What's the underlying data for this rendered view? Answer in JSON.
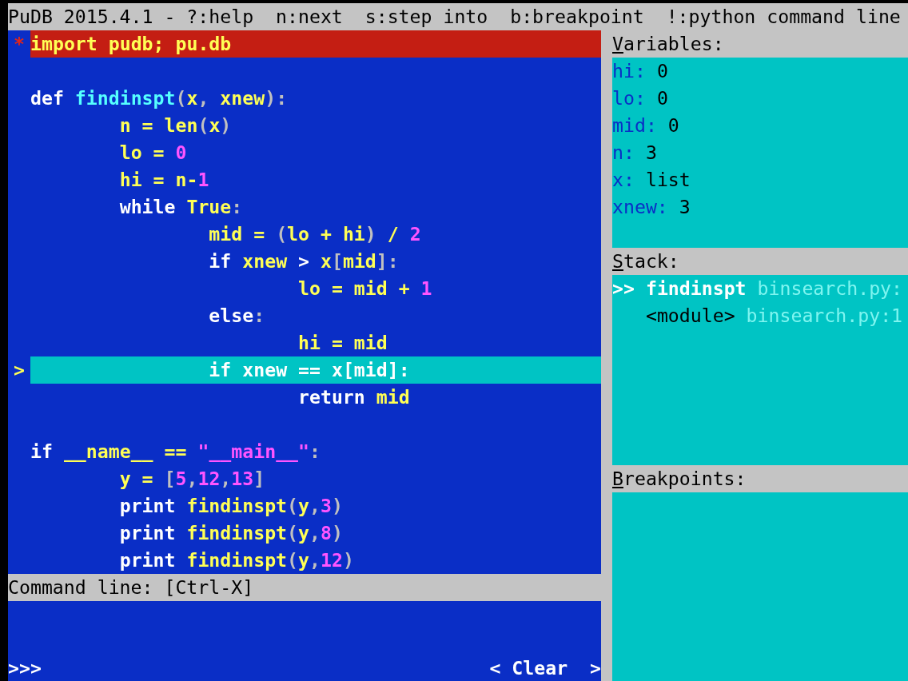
{
  "title_bar": {
    "text": "PuDB 2015.4.1 - ?:help  n:next  s:step into  b:breakpoint  !:python command line"
  },
  "source": {
    "lines": [
      {
        "kind": "breakpoint",
        "marker": "*",
        "tokens": [
          {
            "kind": "name",
            "t": "import pudb; pu.db"
          }
        ]
      },
      {
        "kind": "blank"
      },
      {
        "kind": "normal",
        "tokens": [
          {
            "kind": "kw",
            "t": "def "
          },
          {
            "kind": "func",
            "t": "findinspt"
          },
          {
            "kind": "punct",
            "t": "("
          },
          {
            "kind": "name",
            "t": "x"
          },
          {
            "kind": "punct",
            "t": ", "
          },
          {
            "kind": "name",
            "t": "xnew"
          },
          {
            "kind": "punct",
            "t": "):"
          }
        ],
        "children": [
          {
            "kind": "normal",
            "tokens": [
              {
                "kind": "name",
                "t": "n = len"
              },
              {
                "kind": "punct",
                "t": "("
              },
              {
                "kind": "name",
                "t": "x"
              },
              {
                "kind": "punct",
                "t": ")"
              }
            ]
          },
          {
            "kind": "normal",
            "tokens": [
              {
                "kind": "name",
                "t": "lo = "
              },
              {
                "kind": "num",
                "t": "0"
              }
            ]
          },
          {
            "kind": "normal",
            "tokens": [
              {
                "kind": "name",
                "t": "hi = n-"
              },
              {
                "kind": "num",
                "t": "1"
              }
            ]
          },
          {
            "kind": "normal",
            "tokens": [
              {
                "kind": "kw",
                "t": "while "
              },
              {
                "kind": "name",
                "t": "True"
              },
              {
                "kind": "punct",
                "t": ":"
              }
            ],
            "children": [
              {
                "kind": "normal",
                "tokens": [
                  {
                    "kind": "name",
                    "t": "mid = "
                  },
                  {
                    "kind": "punct",
                    "t": "("
                  },
                  {
                    "kind": "name",
                    "t": "lo + hi"
                  },
                  {
                    "kind": "punct",
                    "t": ")"
                  },
                  {
                    "kind": "name",
                    "t": " / "
                  },
                  {
                    "kind": "num",
                    "t": "2"
                  }
                ]
              },
              {
                "kind": "normal",
                "tokens": [
                  {
                    "kind": "kw",
                    "t": "if "
                  },
                  {
                    "kind": "name",
                    "t": "xnew "
                  },
                  {
                    "kind": "plain",
                    "t": "> "
                  },
                  {
                    "kind": "name",
                    "t": "x"
                  },
                  {
                    "kind": "punct",
                    "t": "["
                  },
                  {
                    "kind": "name",
                    "t": "mid"
                  },
                  {
                    "kind": "punct",
                    "t": "]:"
                  }
                ],
                "children": [
                  {
                    "kind": "normal",
                    "tokens": [
                      {
                        "kind": "name",
                        "t": "lo = mid + "
                      },
                      {
                        "kind": "num",
                        "t": "1"
                      }
                    ]
                  }
                ]
              },
              {
                "kind": "normal",
                "tokens": [
                  {
                    "kind": "kw",
                    "t": "else"
                  },
                  {
                    "kind": "punct",
                    "t": ":"
                  }
                ],
                "children": [
                  {
                    "kind": "normal",
                    "tokens": [
                      {
                        "kind": "name",
                        "t": "hi = mid"
                      }
                    ]
                  }
                ]
              },
              {
                "kind": "current",
                "marker": ">",
                "tokens": [
                  {
                    "kind": "kw",
                    "t": "if "
                  },
                  {
                    "kind": "name",
                    "t": "xnew == x"
                  },
                  {
                    "kind": "punct",
                    "t": "["
                  },
                  {
                    "kind": "name",
                    "t": "mid"
                  },
                  {
                    "kind": "punct",
                    "t": "]:"
                  }
                ],
                "children": [
                  {
                    "kind": "normal",
                    "tokens": [
                      {
                        "kind": "kw",
                        "t": "return "
                      },
                      {
                        "kind": "name",
                        "t": "mid"
                      }
                    ]
                  }
                ]
              }
            ]
          }
        ]
      },
      {
        "kind": "blank"
      },
      {
        "kind": "normal",
        "tokens": [
          {
            "kind": "kw",
            "t": "if "
          },
          {
            "kind": "name",
            "t": "__name__ == "
          },
          {
            "kind": "str",
            "t": "\"__main__\""
          },
          {
            "kind": "punct",
            "t": ":"
          }
        ],
        "children": [
          {
            "kind": "normal",
            "tokens": [
              {
                "kind": "name",
                "t": "y = "
              },
              {
                "kind": "punct",
                "t": "["
              },
              {
                "kind": "num",
                "t": "5"
              },
              {
                "kind": "punct",
                "t": ","
              },
              {
                "kind": "num",
                "t": "12"
              },
              {
                "kind": "punct",
                "t": ","
              },
              {
                "kind": "num",
                "t": "13"
              },
              {
                "kind": "punct",
                "t": "]"
              }
            ]
          },
          {
            "kind": "normal",
            "tokens": [
              {
                "kind": "kw",
                "t": "print "
              },
              {
                "kind": "name",
                "t": "findinspt"
              },
              {
                "kind": "punct",
                "t": "("
              },
              {
                "kind": "name",
                "t": "y"
              },
              {
                "kind": "punct",
                "t": ","
              },
              {
                "kind": "num",
                "t": "3"
              },
              {
                "kind": "punct",
                "t": ")"
              }
            ]
          },
          {
            "kind": "normal",
            "tokens": [
              {
                "kind": "kw",
                "t": "print "
              },
              {
                "kind": "name",
                "t": "findinspt"
              },
              {
                "kind": "punct",
                "t": "("
              },
              {
                "kind": "name",
                "t": "y"
              },
              {
                "kind": "punct",
                "t": ","
              },
              {
                "kind": "num",
                "t": "8"
              },
              {
                "kind": "punct",
                "t": ")"
              }
            ]
          },
          {
            "kind": "normal",
            "tokens": [
              {
                "kind": "kw",
                "t": "print "
              },
              {
                "kind": "name",
                "t": "findinspt"
              },
              {
                "kind": "punct",
                "t": "("
              },
              {
                "kind": "name",
                "t": "y"
              },
              {
                "kind": "punct",
                "t": ","
              },
              {
                "kind": "num",
                "t": "12"
              },
              {
                "kind": "punct",
                "t": ")"
              }
            ]
          }
        ]
      }
    ]
  },
  "command_line": {
    "header": "Command line: [Ctrl-X]",
    "prompt": ">>>",
    "clear_button": "< Clear  >"
  },
  "variables": {
    "title": "Variables:",
    "hotkey_underline": true,
    "items": [
      {
        "name": "hi:",
        "value": "0"
      },
      {
        "name": "lo:",
        "value": "0"
      },
      {
        "name": "mid:",
        "value": "0"
      },
      {
        "name": "n:",
        "value": "3"
      },
      {
        "name": "x:",
        "value": "list"
      },
      {
        "name": "xnew:",
        "value": "3"
      }
    ]
  },
  "stack": {
    "title": "Stack:",
    "hotkey_underline": true,
    "frames": [
      {
        "selected": true,
        "marker": ">>",
        "function": "findinspt",
        "location": "binsearch.py:"
      },
      {
        "selected": false,
        "function": "<module>",
        "location": "binsearch.py:1"
      }
    ]
  },
  "breakpoints": {
    "title": "Breakpoints:",
    "hotkey_underline": true
  }
}
